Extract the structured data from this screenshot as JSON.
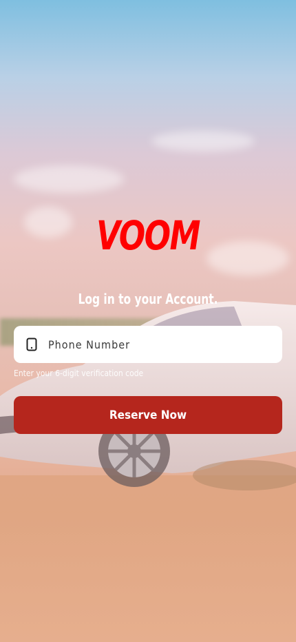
{
  "brand": {
    "logo_text": "VOOM",
    "logo_color": "#ff0000"
  },
  "login": {
    "title": "Log in to your Account.",
    "phone_placeholder": "Phone Number",
    "phone_value": "",
    "hint": "Enter your 6-digit verification code",
    "submit_label": "Reserve Now",
    "submit_color": "#b5261d"
  },
  "icons": {
    "phone": "phone-icon"
  }
}
